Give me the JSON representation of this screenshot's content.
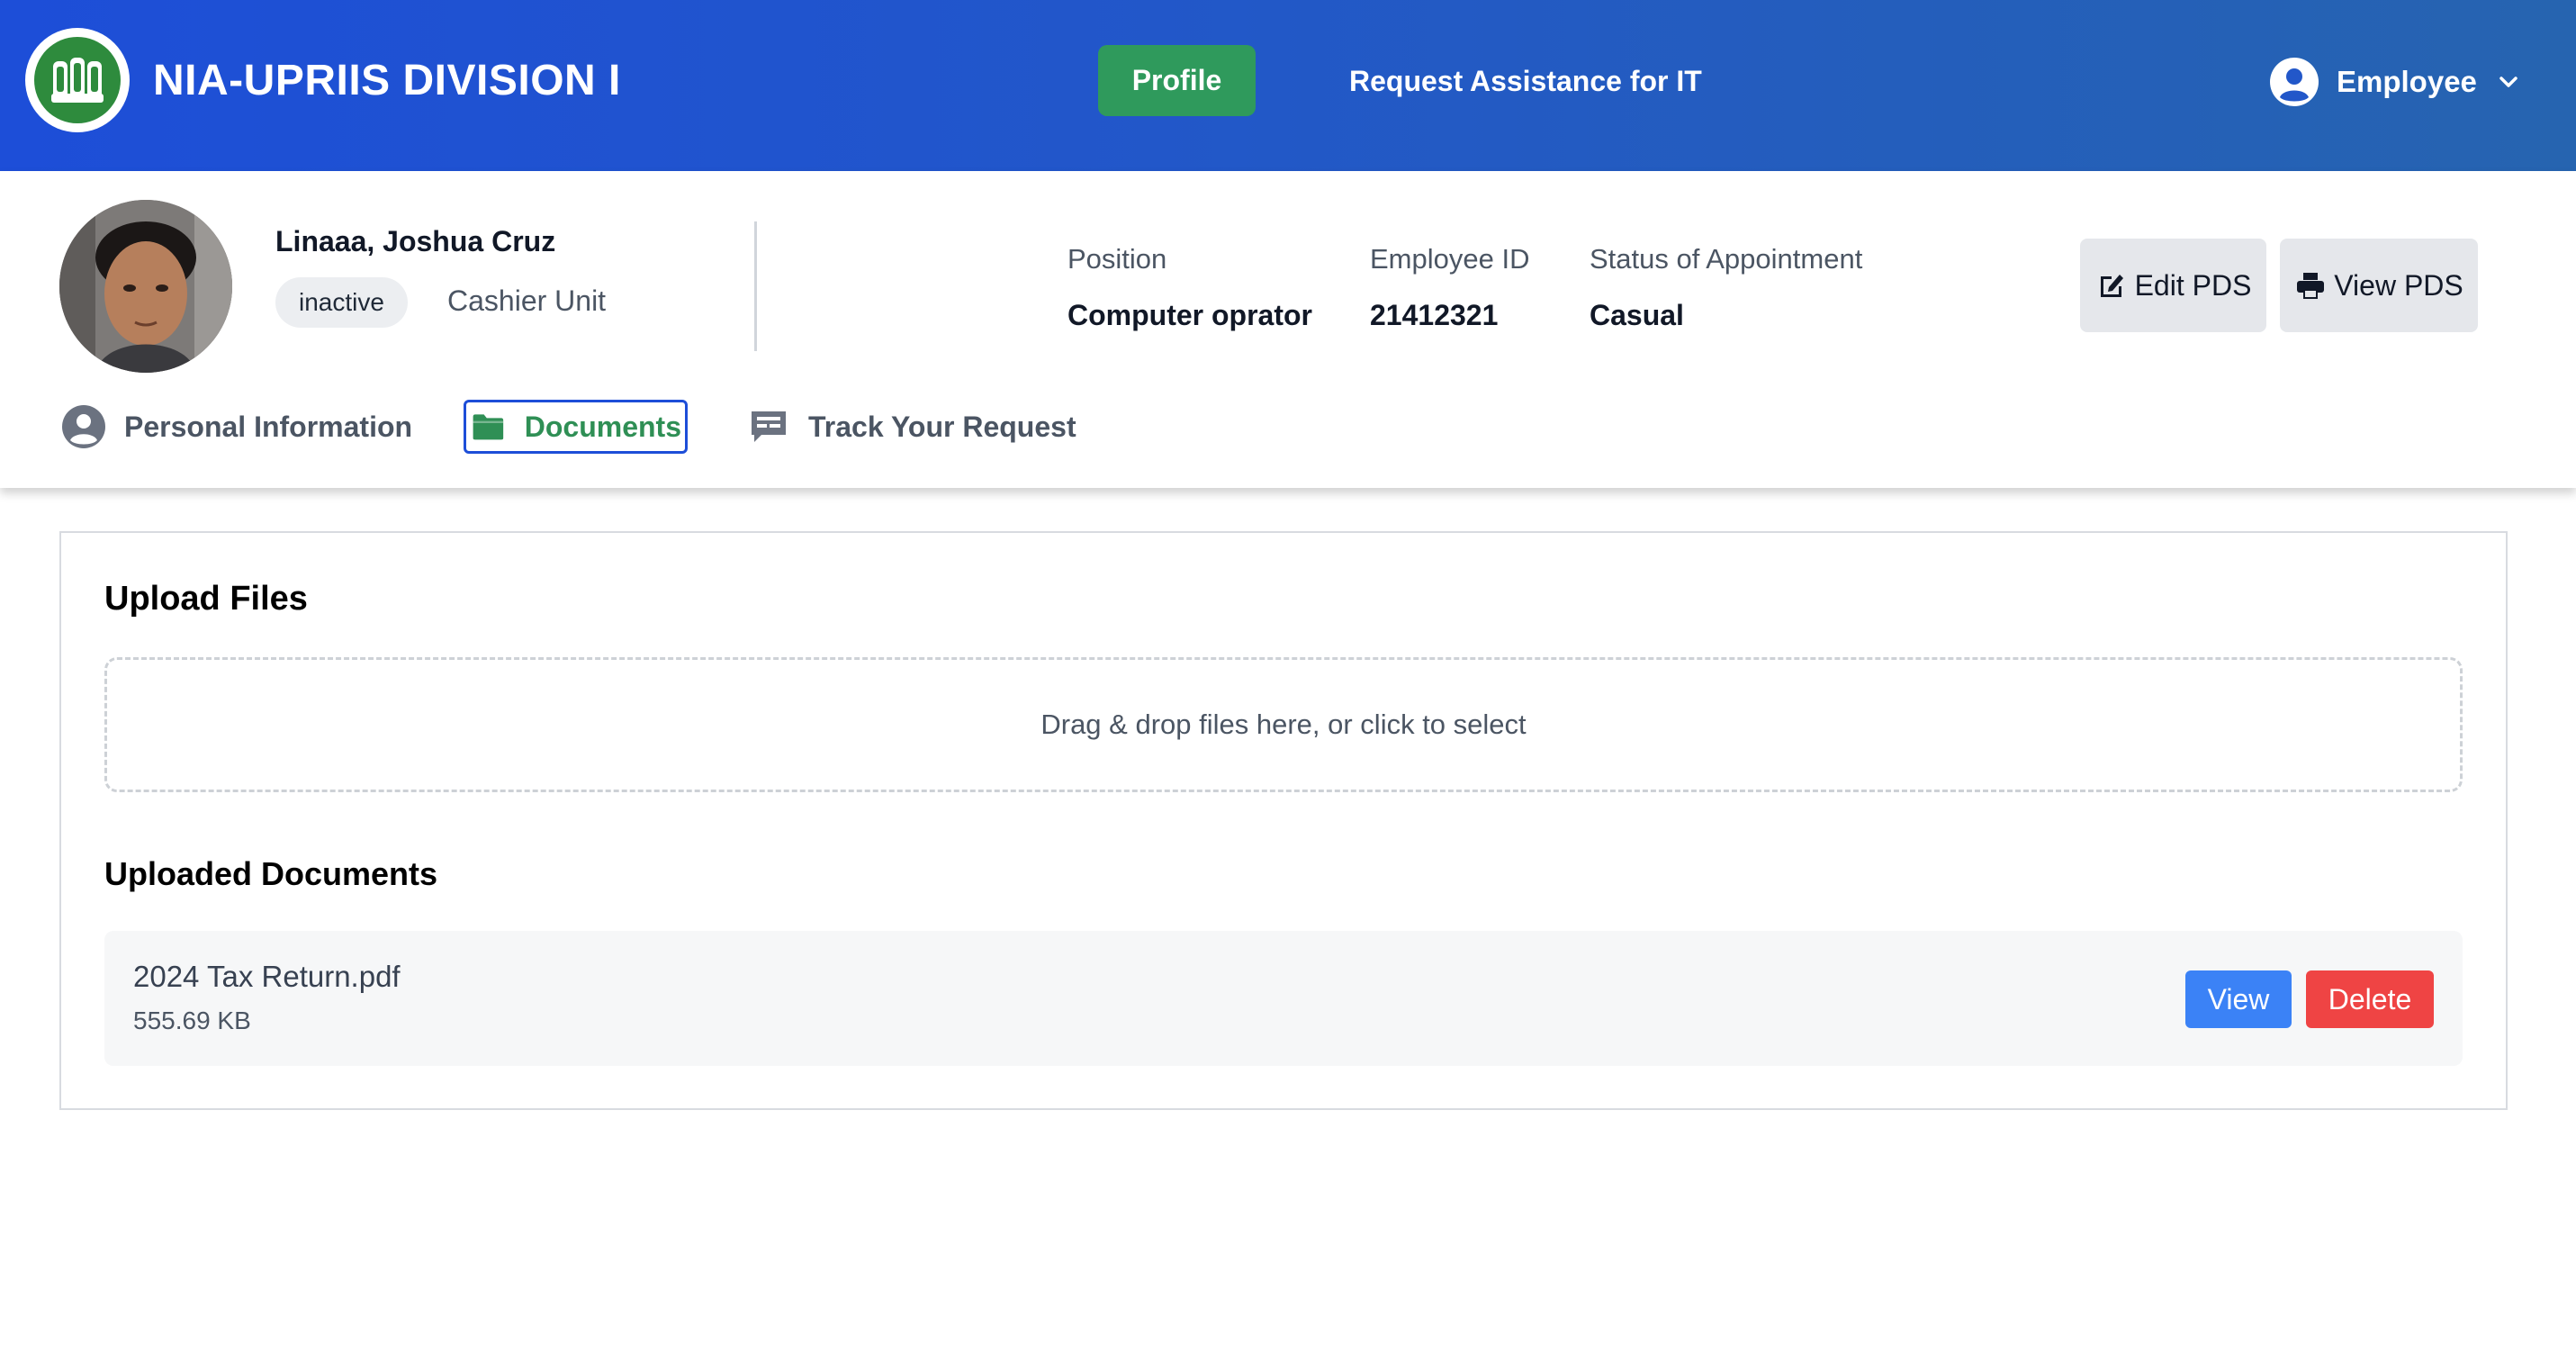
{
  "header": {
    "brand": "NIA-UPRIIS DIVISION I",
    "nav": {
      "profile": "Profile",
      "request_it": "Request Assistance for IT"
    },
    "user_menu": {
      "label": "Employee"
    }
  },
  "profile": {
    "name": "Linaaa, Joshua Cruz",
    "status": "inactive",
    "unit": "Cashier Unit",
    "position": {
      "label": "Position",
      "value": "Computer oprator"
    },
    "employee_id": {
      "label": "Employee ID",
      "value": "21412321"
    },
    "appointment": {
      "label": "Status of Appointment",
      "value": "Casual"
    },
    "buttons": {
      "edit_pds": "Edit PDS",
      "view_pds": "View PDS"
    }
  },
  "tabs": [
    {
      "label": "Personal Information",
      "icon": "user-circle-icon",
      "active": false
    },
    {
      "label": "Documents",
      "icon": "folder-icon",
      "active": true
    },
    {
      "label": "Track Your Request",
      "icon": "chat-icon",
      "active": false
    }
  ],
  "upload": {
    "title": "Upload Files",
    "dropzone_text": "Drag & drop files here, or click to select"
  },
  "documents": {
    "title": "Uploaded Documents",
    "items": [
      {
        "name": "2024 Tax Return.pdf",
        "size": "555.69 KB",
        "view_label": "View",
        "delete_label": "Delete"
      }
    ]
  },
  "colors": {
    "header_start": "#1d4ed8",
    "header_end": "#2664b0",
    "accent_green": "#2f9a5c",
    "view_blue": "#3b82f6",
    "delete_red": "#ef4444"
  }
}
